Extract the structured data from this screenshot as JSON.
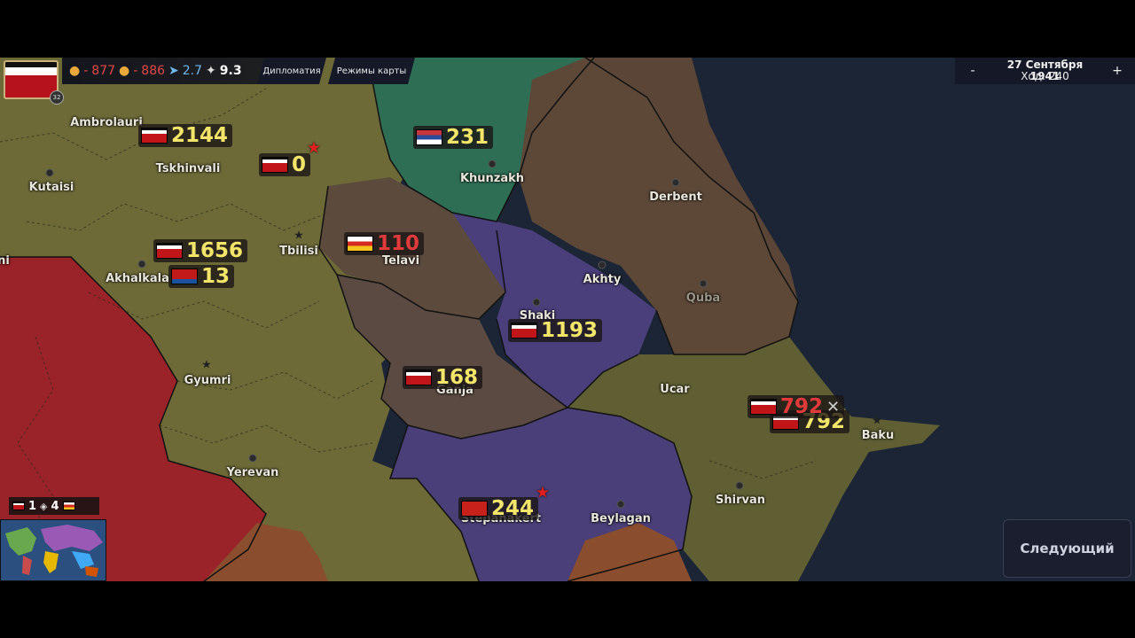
{
  "hud": {
    "player_badge": "32",
    "resources": [
      {
        "icon": "gold-icon",
        "prefix": "-",
        "value": "877",
        "style": "neg"
      },
      {
        "icon": "food-icon",
        "prefix": "-",
        "value": "886",
        "style": "neg"
      },
      {
        "icon": "plane-icon",
        "prefix": "",
        "value": "2.7",
        "style": "pos"
      },
      {
        "icon": "dove-icon",
        "prefix": "",
        "value": "9.3",
        "style": "white"
      }
    ],
    "tabs": [
      "Дипломатия",
      "Режимы карты"
    ],
    "date": "27 Сентября 1941",
    "turn": "Ход: 240",
    "minus_label": "-",
    "plus_label": "+",
    "next_button": "Следующий"
  },
  "alliance": {
    "count1": "1",
    "count2": "4"
  },
  "cities": [
    {
      "name": "Ambrolauri"
    },
    {
      "name": "Tskhinvali"
    },
    {
      "name": "Kutaisi"
    },
    {
      "name": "Tbilisi"
    },
    {
      "name": "Akhalkala"
    },
    {
      "name": "Telavi"
    },
    {
      "name": "Khunzakh"
    },
    {
      "name": "Derbent"
    },
    {
      "name": "Akhty"
    },
    {
      "name": "Quba"
    },
    {
      "name": "Shaki"
    },
    {
      "name": "Ganja"
    },
    {
      "name": "Gyumri"
    },
    {
      "name": "Ucar"
    },
    {
      "name": "Baku"
    },
    {
      "name": "Yerevan"
    },
    {
      "name": "Shirvan"
    },
    {
      "name": "Beylagan"
    },
    {
      "name": "Stepanakert"
    },
    {
      "name": "ni"
    }
  ],
  "units": [
    {
      "value": "2144",
      "flag": "white"
    },
    {
      "value": "0",
      "flag": "white"
    },
    {
      "value": "231",
      "flag": "serb"
    },
    {
      "value": "110",
      "flag": "ossetia"
    },
    {
      "value": "1656",
      "flag": "white"
    },
    {
      "value": "13",
      "flag": "armred"
    },
    {
      "value": "1193",
      "flag": "white"
    },
    {
      "value": "168",
      "flag": "white"
    },
    {
      "value": "792",
      "flag": "white"
    },
    {
      "value": "792",
      "flag": "white"
    },
    {
      "value": "244",
      "flag": "sov"
    }
  ],
  "colors": {
    "georgia": "#6f6a36",
    "russia_green": "#2e6e55",
    "dagestan_brown": "#5d4838",
    "azer_purple": "#4a3f7a",
    "armenia_red": "#9a2229",
    "azer_olive": "#5f5f33",
    "sea": "#1c2536"
  }
}
